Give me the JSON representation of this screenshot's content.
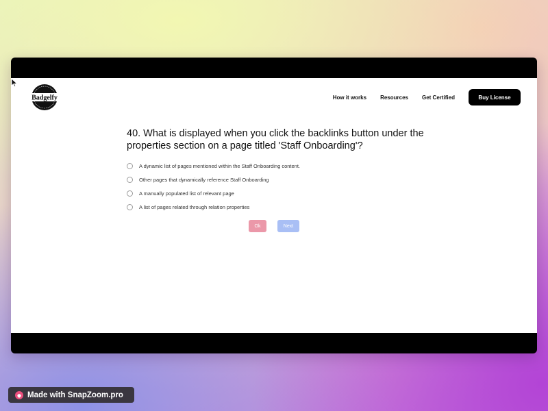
{
  "brand": {
    "logo_text": "Badgelfy"
  },
  "nav": {
    "links": [
      "How it works",
      "Resources",
      "Get Certified"
    ],
    "buy_label": "Buy License"
  },
  "quiz": {
    "question": "40. What is displayed when you click the backlinks button under the properties section on a page titled 'Staff Onboarding'?",
    "options": [
      "A dynamic list of pages mentioned within the Staff Onboarding content.",
      "Other pages that dynamically reference Staff Onboarding",
      "A manually populated list of relevant page",
      "A list of pages related through relation properties"
    ],
    "ok_label": "Ok",
    "next_label": "Next"
  },
  "watermark": {
    "text": "Made with SnapZoom.pro"
  },
  "colors": {
    "ok_button": "#eb98a9",
    "next_button": "#a9bff5",
    "buy_button": "#000000"
  }
}
